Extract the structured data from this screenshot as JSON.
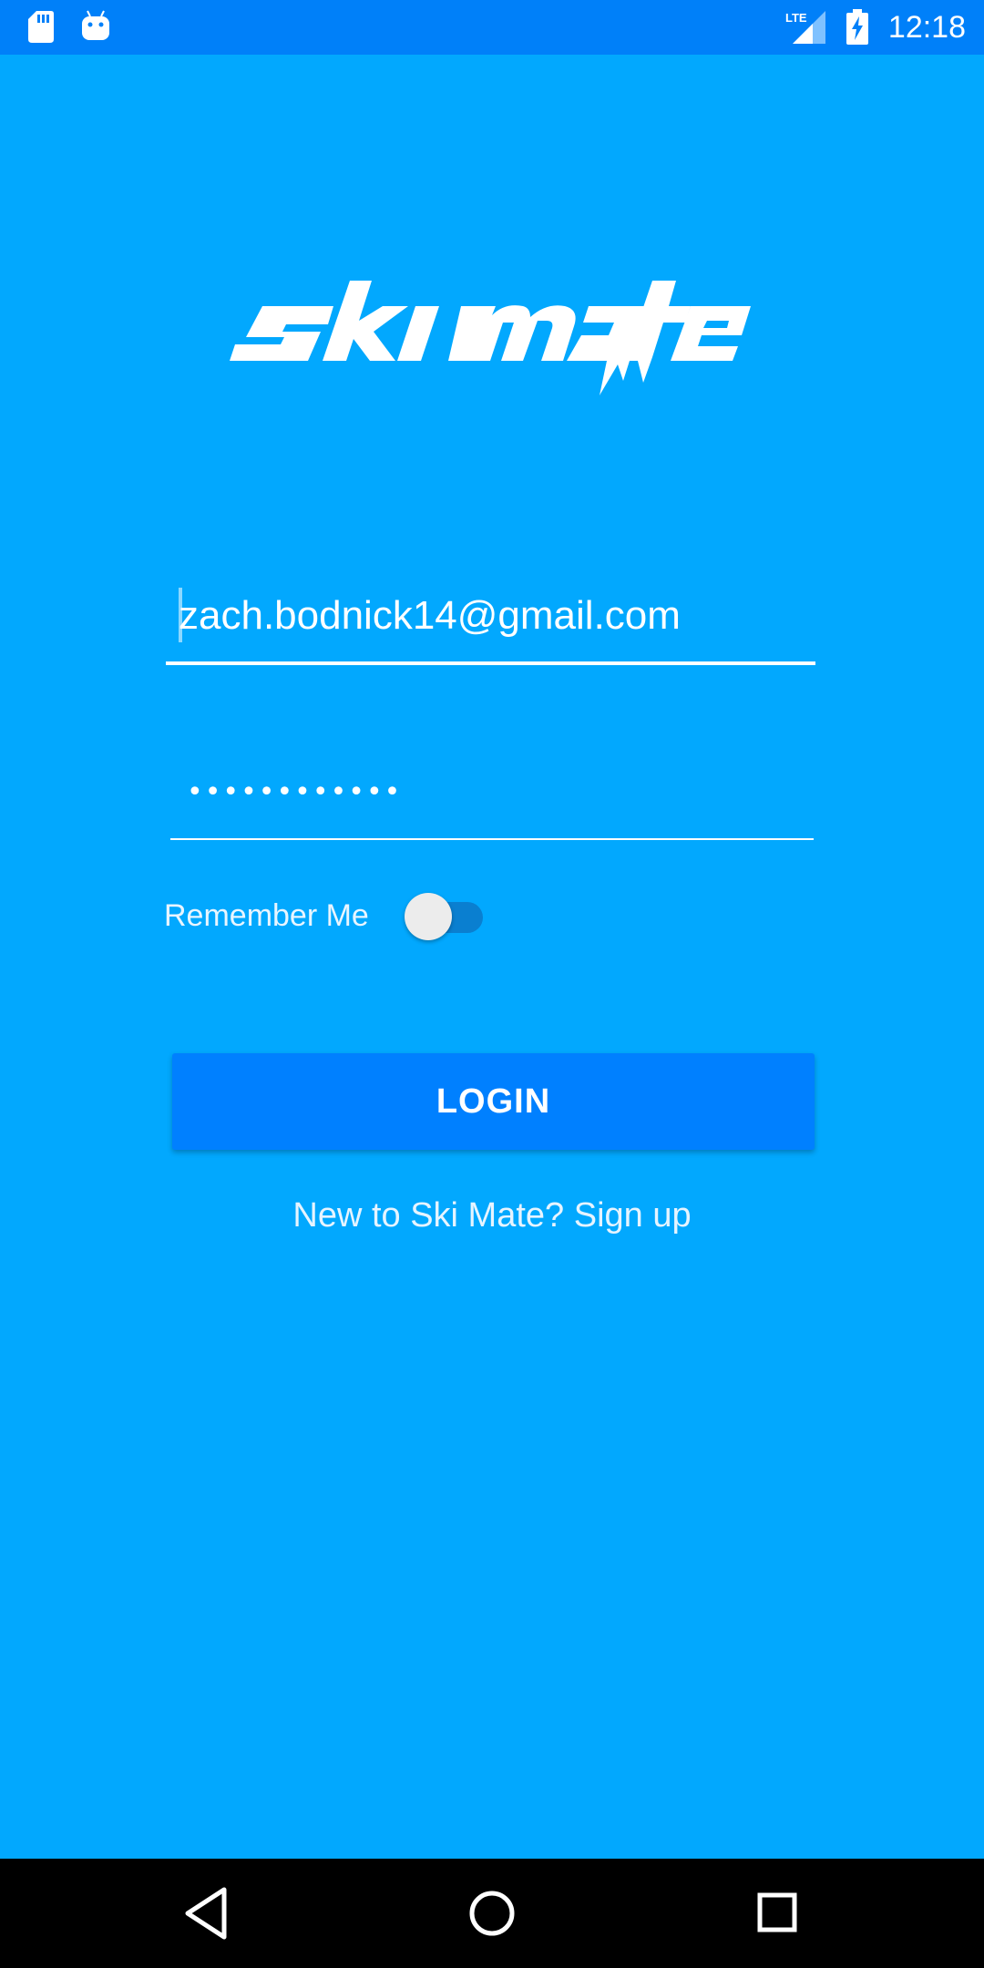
{
  "status_bar": {
    "time": "12:18",
    "network": "LTE",
    "icons": [
      "sd-card-icon",
      "android-debug-icon",
      "lte-signal-icon",
      "battery-charging-icon"
    ]
  },
  "logo": {
    "text": "ski mate"
  },
  "login_form": {
    "email_value": "zach.bodnick14@gmail.com",
    "password_value": "••••••••••••",
    "remember_label": "Remember Me",
    "remember_checked": false,
    "login_label": "LOGIN",
    "signup_text": "New to Ski Mate? Sign up"
  },
  "nav_bar": {
    "icons": [
      "back-icon",
      "home-icon",
      "recents-icon"
    ]
  },
  "colors": {
    "status_bar": "#0080f9",
    "background": "#02a8fe",
    "button": "#0080ff",
    "toggle_track": "#0a7fd0",
    "nav_bar": "#000000"
  }
}
